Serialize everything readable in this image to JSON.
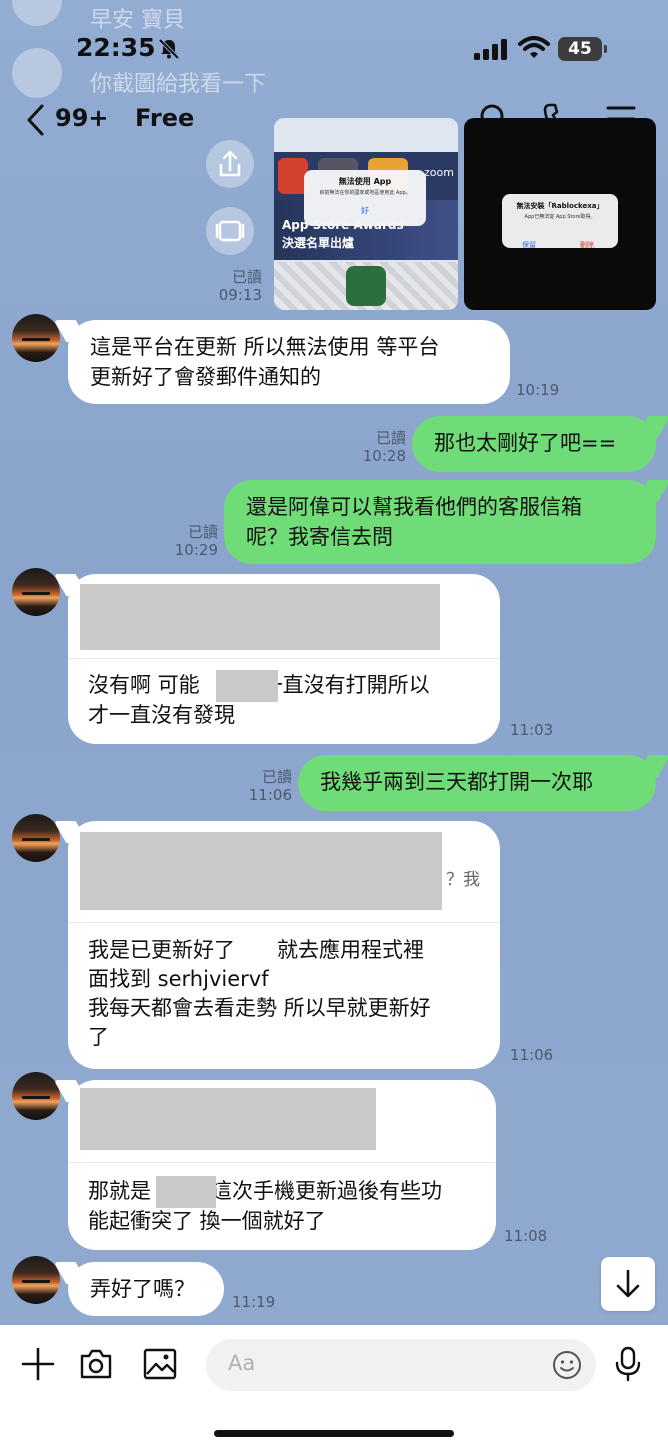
{
  "status_bar": {
    "time": "22:35",
    "battery": "45"
  },
  "ghost_notifications": [
    "早安 寶貝",
    "你截圖給我看一下"
  ],
  "header": {
    "back_count": "99+",
    "title": "Free"
  },
  "screenshots": {
    "read_label": "已讀",
    "time": "09:13",
    "left": {
      "banner": "App Store Awards",
      "banner_sub": "決選名單出爐",
      "dialog_title": "無法使用 App",
      "dialog_body": "目前無法在你的國家或地區使用此 App。",
      "dialog_button": "好",
      "tile_label": "zoom"
    },
    "right": {
      "dialog_title": "無法安裝「Rablockexa」",
      "dialog_body": "App已無法從 App Store取得。",
      "btn_keep": "保留",
      "btn_delete": "刪除"
    }
  },
  "messages": [
    {
      "dir": "in",
      "text": "這是平台在更新 所以無法使用 等平台\n更新好了會發郵件通知的",
      "time": "10:19"
    },
    {
      "dir": "out",
      "text": "那也太剛好了吧==",
      "read": "已讀",
      "time": "10:28"
    },
    {
      "dir": "out",
      "text": "還是阿偉可以幫我看他們的客服信箱\n呢？我寄信去問",
      "read": "已讀",
      "time": "10:29"
    },
    {
      "dir": "in",
      "text_a": "沒有啊 可能",
      "text_b": "一直沒有打開所以",
      "text_c": "才一直沒有發現",
      "time": "11:03"
    },
    {
      "dir": "out",
      "text": "我幾乎兩到三天都打開一次耶",
      "read": "已讀",
      "time": "11:06"
    },
    {
      "dir": "in",
      "quote_suffix": "？我",
      "text": "我是已更新好了　　就去應用程式裡\n面找到 serhjviervf\n我每天都會去看走勢 所以早就更新好\n了",
      "time": "11:06"
    },
    {
      "dir": "in",
      "text_a": "那就是",
      "text_b": "這次手機更新過後有些功",
      "text_c": "能起衝突了 換一個就好了",
      "time": "11:08"
    },
    {
      "dir": "in",
      "text": "弄好了嗎？",
      "time": "11:19"
    }
  ],
  "input": {
    "placeholder": "Aa"
  },
  "colors": {
    "bg": "#8fa8cd",
    "outgoing": "#6fdc78",
    "incoming": "#ffffff"
  }
}
